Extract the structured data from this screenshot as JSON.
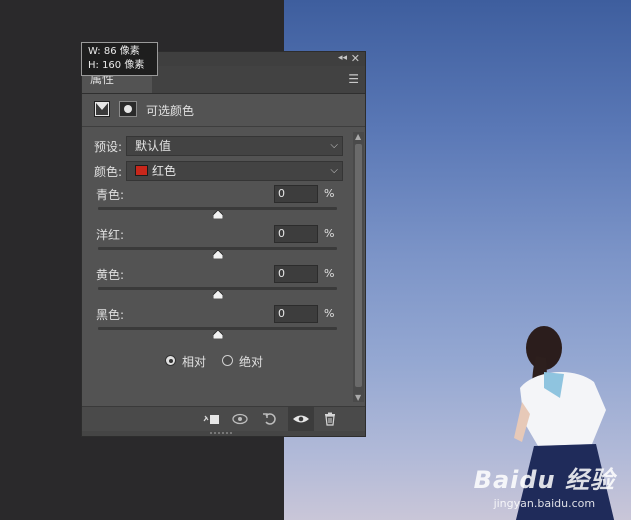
{
  "tooltip": {
    "w_line": "W:   86 像素",
    "h_line": "H:  160 像素"
  },
  "panel": {
    "tab_label": "属性",
    "title": "可选颜色",
    "preset_label": "预设:",
    "preset_value": "默认值",
    "colors_label": "颜色:",
    "colors_value": "红色",
    "colors_swatch": "#c8271b",
    "sliders": [
      {
        "label": "青色:",
        "value": "0",
        "unit": "%",
        "level": 0.5
      },
      {
        "label": "洋红:",
        "value": "0",
        "unit": "%",
        "level": 0.5
      },
      {
        "label": "黄色:",
        "value": "0",
        "unit": "%",
        "level": 0.5
      },
      {
        "label": "黑色:",
        "value": "0",
        "unit": "%",
        "level": 0.5
      }
    ],
    "method": {
      "relative_label": "相对",
      "absolute_label": "绝对",
      "selected": "relative"
    },
    "bottom_icons": [
      "clip-to-layer-icon",
      "view-previous-state-icon",
      "reset-icon",
      "visibility-eye-icon",
      "trash-icon"
    ]
  },
  "watermark": {
    "logo": "Baidu 经验",
    "url": "jingyan.baidu.com"
  }
}
